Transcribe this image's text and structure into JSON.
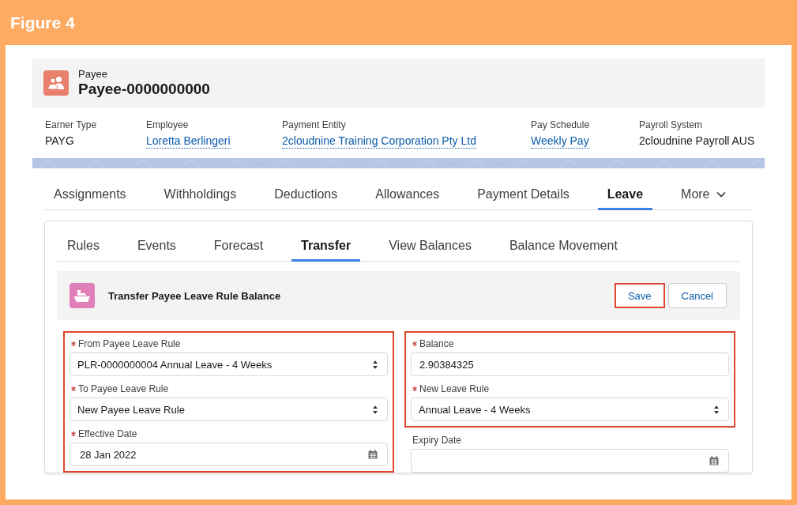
{
  "figure": {
    "title": "Figure 4"
  },
  "record_header": {
    "object_label": "Payee",
    "record_name": "Payee-0000000000"
  },
  "highlights_panel": [
    {
      "label": "Earner Type",
      "value": "PAYG",
      "link": false
    },
    {
      "label": "Employee",
      "value": "Loretta Berlingeri",
      "link": true
    },
    {
      "label": "Payment Entity",
      "value": "2cloudnine Training Corporation Pty Ltd",
      "link": true
    },
    {
      "label": "Pay Schedule",
      "value": "Weekly Pay",
      "link": true
    },
    {
      "label": "Payroll System",
      "value": "2cloudnine Payroll AUS",
      "link": false
    }
  ],
  "tabs": [
    {
      "label": "Assignments",
      "selected": false
    },
    {
      "label": "Withholdings",
      "selected": false
    },
    {
      "label": "Deductions",
      "selected": false
    },
    {
      "label": "Allowances",
      "selected": false
    },
    {
      "label": "Payment Details",
      "selected": false
    },
    {
      "label": "Leave",
      "selected": true
    }
  ],
  "more_menu": {
    "label": "More"
  },
  "subtabs": [
    {
      "label": "Rules",
      "selected": false
    },
    {
      "label": "Events",
      "selected": false
    },
    {
      "label": "Forecast",
      "selected": false
    },
    {
      "label": "Transfer",
      "selected": true
    },
    {
      "label": "View Balances",
      "selected": false
    },
    {
      "label": "Balance Movement",
      "selected": false
    }
  ],
  "section": {
    "title": "Transfer Payee Leave Rule Balance",
    "buttons": [
      {
        "label": "Save",
        "highlighted": true
      },
      {
        "label": "Cancel",
        "highlighted": false
      }
    ]
  },
  "form": {
    "columns": [
      {
        "groups": [
          {
            "highlighted": true,
            "fields": [
              {
                "kind": "select",
                "label": "From Payee Leave Rule",
                "required": true,
                "value": "PLR-0000000004 Annual Leave - 4 Weeks"
              },
              {
                "kind": "select",
                "label": "To Payee Leave Rule",
                "required": true,
                "value": "New Payee Leave Rule"
              },
              {
                "kind": "date",
                "label": "Effective Date",
                "required": true,
                "value": "28 Jan 2022"
              }
            ]
          }
        ]
      },
      {
        "groups": [
          {
            "highlighted": true,
            "fields": [
              {
                "kind": "text",
                "label": "Balance",
                "required": true,
                "value": "2.90384325"
              },
              {
                "kind": "select",
                "label": "New Leave Rule",
                "required": true,
                "value": "Annual Leave - 4 Weeks"
              }
            ]
          },
          {
            "highlighted": false,
            "fields": [
              {
                "kind": "date",
                "label": "Expiry Date",
                "required": false
              }
            ]
          }
        ]
      }
    ]
  }
}
